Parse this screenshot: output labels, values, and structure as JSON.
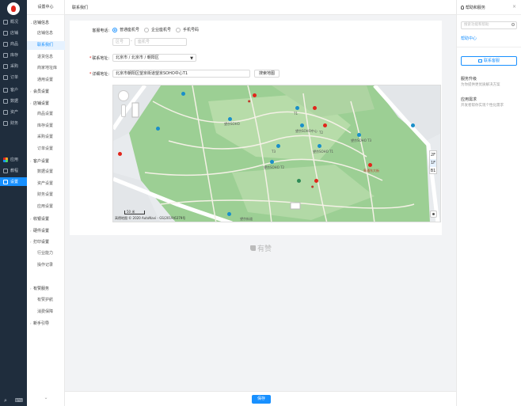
{
  "rail": {
    "items": [
      {
        "label": "概况",
        "icon": "overview-icon"
      },
      {
        "label": "店铺",
        "icon": "store-icon"
      },
      {
        "label": "商品",
        "icon": "goods-icon"
      },
      {
        "label": "库存",
        "icon": "inventory-icon"
      },
      {
        "label": "采购",
        "icon": "purchase-icon"
      },
      {
        "label": "订单",
        "icon": "order-icon"
      },
      {
        "label": "客户",
        "icon": "customer-icon"
      },
      {
        "label": "数据",
        "icon": "data-icon"
      },
      {
        "label": "资产",
        "icon": "asset-icon"
      },
      {
        "label": "财务",
        "icon": "finance-icon"
      },
      {
        "label": "应用",
        "icon": "apps-icon"
      },
      {
        "label": "教程",
        "icon": "tutorial-icon"
      },
      {
        "label": "设置",
        "icon": "settings-icon"
      }
    ],
    "active": "设置"
  },
  "subnav": {
    "title": "设置中心",
    "items": [
      {
        "label": "店铺信息",
        "type": "group",
        "expanded": true
      },
      {
        "label": "店铺信息",
        "type": "child"
      },
      {
        "label": "联系我们",
        "type": "child",
        "active": true
      },
      {
        "label": "退货信息",
        "type": "child"
      },
      {
        "label": "商家地址库",
        "type": "child"
      },
      {
        "label": "通用设置",
        "type": "child"
      },
      {
        "label": "会员设置",
        "type": "group"
      },
      {
        "label": "店铺设置",
        "type": "group"
      },
      {
        "label": "商品设置",
        "type": "child"
      },
      {
        "label": "库存设置",
        "type": "child"
      },
      {
        "label": "采购设置",
        "type": "child"
      },
      {
        "label": "订单设置",
        "type": "child"
      },
      {
        "label": "客户设置",
        "type": "group"
      },
      {
        "label": "数据设置",
        "type": "child"
      },
      {
        "label": "资产设置",
        "type": "child"
      },
      {
        "label": "财务设置",
        "type": "child"
      },
      {
        "label": "应用设置",
        "type": "child"
      },
      {
        "label": "收银设置",
        "type": "group"
      },
      {
        "label": "硬件设置",
        "type": "group"
      },
      {
        "label": "打印设置",
        "type": "group"
      },
      {
        "label": "行业能力",
        "type": "child"
      },
      {
        "label": "操作记录",
        "type": "child"
      },
      {
        "label": "有赞服务",
        "type": "group"
      },
      {
        "label": "有赞护航",
        "type": "child"
      },
      {
        "label": "消费保障",
        "type": "child"
      },
      {
        "label": "新手引导",
        "type": "group"
      }
    ]
  },
  "topbar": {
    "breadcrumb": "联系我们"
  },
  "form": {
    "phone_label": "客服电话:",
    "phone_types": [
      "普通座机号",
      "企业座机号",
      "手机号码"
    ],
    "phone_selected": "普通座机号",
    "area_code_placeholder": "区号",
    "phone_placeholder": "座机号",
    "address_label": "联系地址:",
    "address_value": "北京市 / 北京市 / 朝阳区",
    "detail_label": "详细地址:",
    "detail_value": "北京市朝阳区望京街道望京SOHO中心T1",
    "search_map_label": "搜索地图"
  },
  "map": {
    "pois": [
      "望京SOHO",
      "望京SOHO T2",
      "望京SOHO T3",
      "T1",
      "T3",
      "T2",
      "望京SOHO中心",
      "望京SOHO T1",
      "阜通东大街",
      "望京街道"
    ],
    "floors": [
      "2F",
      "1F",
      "B1"
    ],
    "floor_selected": "1F",
    "scale": "50 米",
    "copyright": "高德地图 © 2020 AutoNavi - GS(2019)6379号"
  },
  "like_label": "有赞",
  "footer": {
    "save_label": "保存"
  },
  "help": {
    "title": "帮助和服务",
    "search_placeholder": "搜索功能和帮助",
    "help_center": "帮助中心",
    "contact_button": "联系客服",
    "service_title": "服务升级",
    "service_desc": "为你提供更优质解决方案",
    "feedback_title": "应用需求",
    "feedback_desc": "开发者帮你实现个性化需求"
  },
  "colors": {
    "accent": "#1890ff",
    "rail": "#1f2d3d",
    "brand": "#e1251b"
  }
}
